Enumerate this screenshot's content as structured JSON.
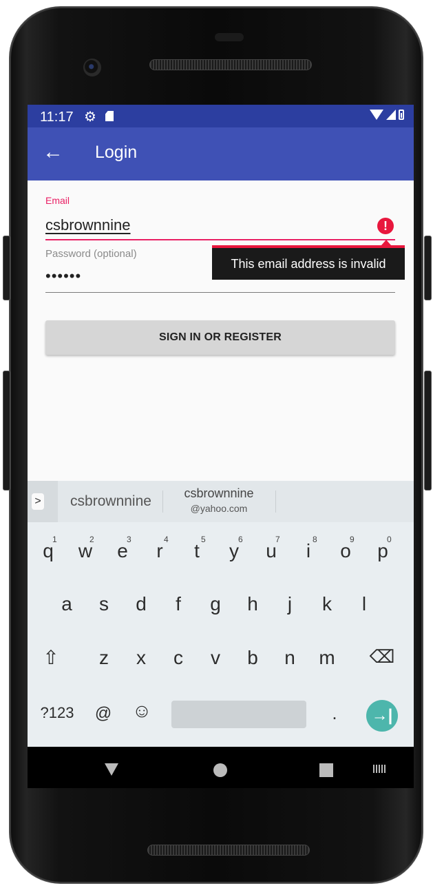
{
  "status_bar": {
    "time": "11:17"
  },
  "app_bar": {
    "title": "Login",
    "back_icon": "←"
  },
  "form": {
    "email_label": "Email",
    "email_value": "csbrownnine",
    "error_tooltip": "This email address is invalid",
    "password_label": "Password (optional)",
    "password_value": "••••••",
    "submit_label": "SIGN IN OR REGISTER"
  },
  "keyboard": {
    "suggestions": {
      "toggle": ">",
      "primary": "csbrownnine",
      "secondary_line1": "csbrownnine",
      "secondary_line2": "@yahoo.com"
    },
    "row1": [
      "q",
      "w",
      "e",
      "r",
      "t",
      "y",
      "u",
      "i",
      "o",
      "p"
    ],
    "row1_hints": [
      "1",
      "2",
      "3",
      "4",
      "5",
      "6",
      "7",
      "8",
      "9",
      "0"
    ],
    "row2": [
      "a",
      "s",
      "d",
      "f",
      "g",
      "h",
      "j",
      "k",
      "l"
    ],
    "row3": [
      "z",
      "x",
      "c",
      "v",
      "b",
      "n",
      "m"
    ],
    "symbols_label": "?123",
    "at_key": "@",
    "emoji_key": "☺",
    "period_key": ".",
    "shift_key": "⇧",
    "backspace_key": "⌫",
    "enter_key": "→|"
  },
  "colors": {
    "status_bar": "#2c3ea0",
    "app_bar": "#3f51b5",
    "accent_error": "#e91e63",
    "error_icon": "#e8173d",
    "enter_key": "#4db6ac"
  }
}
